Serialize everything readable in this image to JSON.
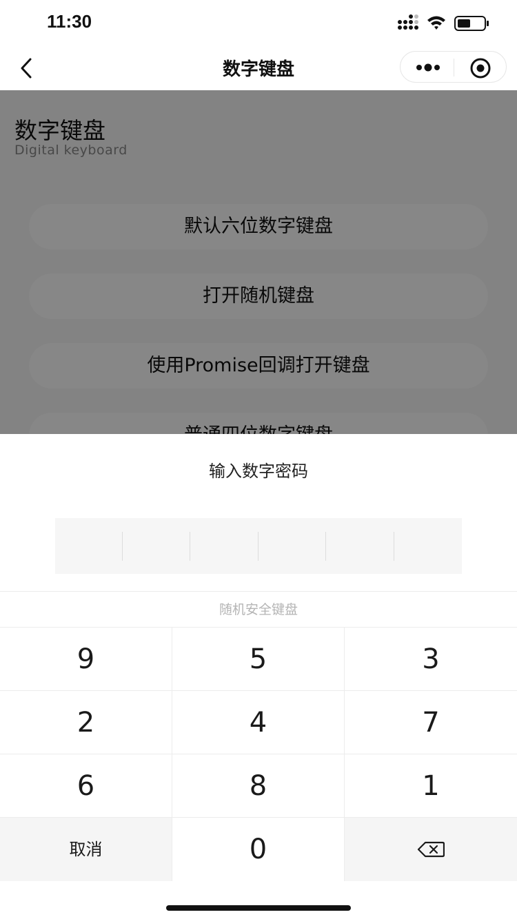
{
  "status_bar": {
    "time": "11:30"
  },
  "nav": {
    "title": "数字键盘"
  },
  "page": {
    "title": "数字键盘",
    "subtitle": "Digital keyboard",
    "buttons": [
      "默认六位数字键盘",
      "打开随机键盘",
      "使用Promise回调打开键盘",
      "普通四位数字键盘"
    ]
  },
  "keyboard": {
    "title": "输入数字密码",
    "digits_count": 6,
    "hint": "随机安全键盘",
    "keys": [
      "9",
      "5",
      "3",
      "2",
      "4",
      "7",
      "6",
      "8",
      "1"
    ],
    "cancel_label": "取消",
    "zero_key": "0",
    "delete_icon": "backspace-icon"
  },
  "colors": {
    "overlay": "#7a7a7a",
    "key_func_bg": "#f5f5f5"
  }
}
